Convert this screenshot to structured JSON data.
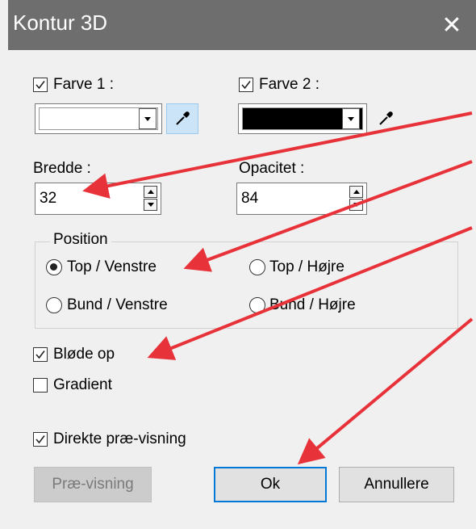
{
  "window": {
    "title": "Kontur 3D",
    "close_glyph": "✕"
  },
  "color1": {
    "checkbox_label": "Farve 1 :",
    "checked": true,
    "swatch": "#ffffff"
  },
  "color2": {
    "checkbox_label": "Farve 2 :",
    "checked": true,
    "swatch": "#000000"
  },
  "width": {
    "label": "Bredde :",
    "value": "32"
  },
  "opacity": {
    "label": "Opacitet :",
    "value": "84"
  },
  "position": {
    "label": "Position",
    "options": [
      {
        "label": "Top / Venstre",
        "selected": true
      },
      {
        "label": "Top / Højre",
        "selected": false
      },
      {
        "label": "Bund / Venstre",
        "selected": false
      },
      {
        "label": "Bund / Højre",
        "selected": false
      }
    ]
  },
  "blur": {
    "label": "Bløde op",
    "checked": true
  },
  "gradient": {
    "label": "Gradient",
    "checked": false
  },
  "direct_preview": {
    "label": "Direkte præ-visning",
    "checked": true
  },
  "buttons": {
    "preview": "Præ-visning",
    "ok": "Ok",
    "cancel": "Annullere"
  },
  "annotation_color": "#e8323a"
}
